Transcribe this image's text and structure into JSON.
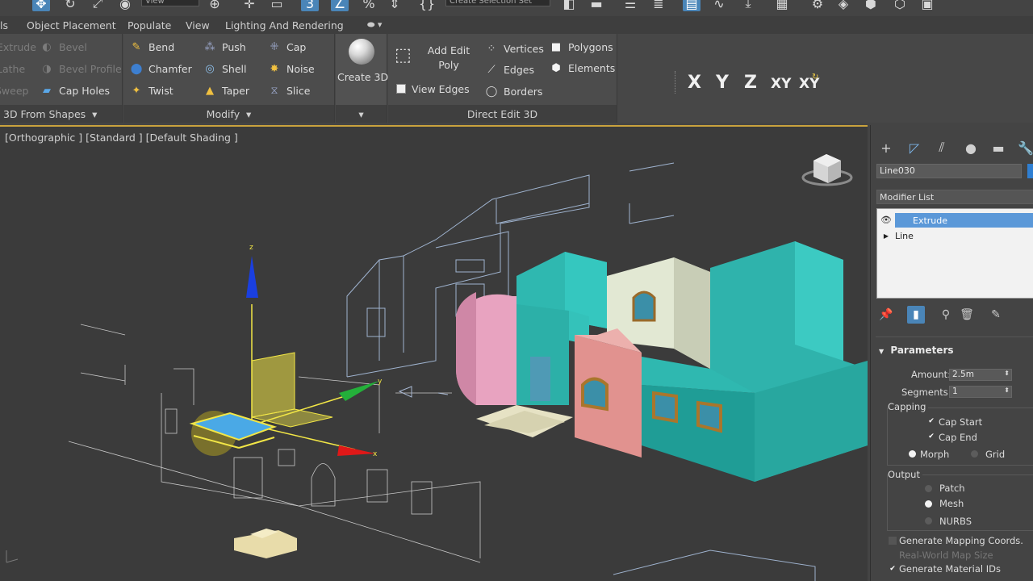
{
  "ribbon_tabs": [
    "Object Placement",
    "Populate",
    "View",
    "Lighting And Rendering"
  ],
  "ribbon_tab_partial": "ls",
  "top_dropdown": "Create Selection Set",
  "top_dropdown_left": "View",
  "shapes_group": {
    "items": [
      "Extrude",
      "Bevel",
      "Lathe",
      "Bevel Profile",
      "Sweep",
      "Cap Holes"
    ],
    "footer": "3D From Shapes"
  },
  "modify_group": {
    "col1": [
      "Bend",
      "Chamfer",
      "Twist"
    ],
    "col2": [
      "Push",
      "Shell",
      "Taper"
    ],
    "col3": [
      "Cap",
      "Noise",
      "Slice"
    ],
    "footer": "Modify"
  },
  "create3d_label": "Create 3D",
  "direct_edit": {
    "add_edit_poly": "Add Edit Poly",
    "view_edges": "View Edges",
    "vertices": "Vertices",
    "edges": "Edges",
    "borders": "Borders",
    "polygons": "Polygons",
    "elements": "Elements",
    "footer": "Direct Edit 3D"
  },
  "axis_constraints": [
    "X",
    "Y",
    "Z",
    "XY",
    "XY"
  ],
  "viewport_label": "[Orthographic ] [Standard ] [Default Shading ]",
  "command_panel": {
    "object_name": "Line030",
    "object_color": "#2f7fd2",
    "modifier_list_label": "Modifier List",
    "stack": [
      "Extrude",
      "Line"
    ],
    "parameters_title": "Parameters",
    "amount_label": "Amount:",
    "amount_value": "2.5m",
    "segments_label": "Segments:",
    "segments_value": "1",
    "capping_label": "Capping",
    "cap_start": "Cap Start",
    "cap_end": "Cap End",
    "morph": "Morph",
    "grid": "Grid",
    "output_label": "Output",
    "patch": "Patch",
    "mesh": "Mesh",
    "nurbs": "NURBS",
    "gen_mapping": "Generate Mapping Coords.",
    "real_world": "Real-World Map Size",
    "gen_material": "Generate Material IDs"
  },
  "colors": {
    "selection_blue": "#5b98d8",
    "viewport_border": "#c9a23d",
    "teal_walls": "#2bb5ad",
    "pink_wall": "#e29fbb",
    "cream_wall": "#dfe6cf",
    "salmon_wall": "#e0918d",
    "gizmo_yellow": "#f2e646"
  }
}
